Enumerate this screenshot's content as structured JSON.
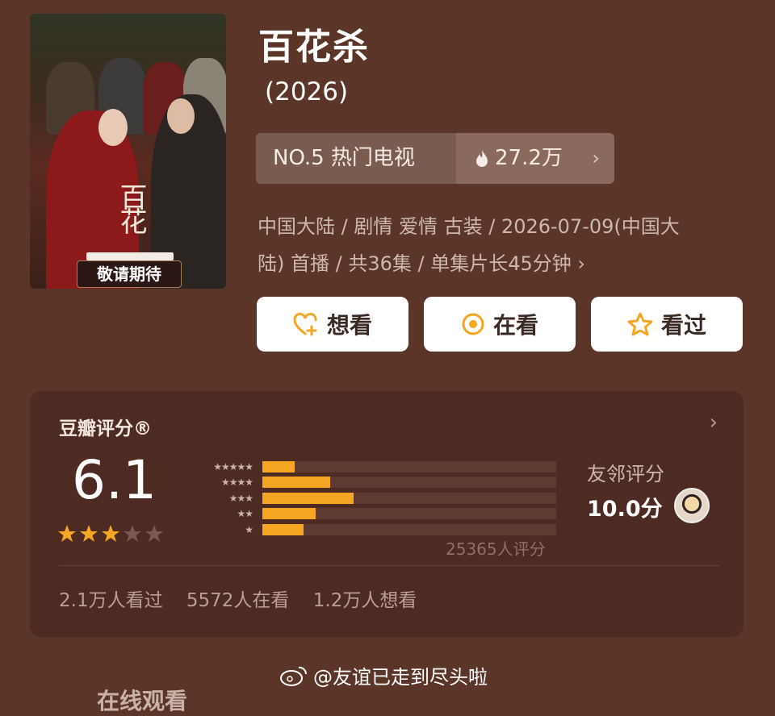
{
  "movie": {
    "title": "百花杀",
    "year": "(2026)",
    "poster_tag": "敬请期待",
    "poster_calligraphy": "百花"
  },
  "rank": {
    "label": "NO.5 热门电视",
    "heat": "27.2万",
    "chevron": "›"
  },
  "meta": {
    "line1": "中国大陆 / 剧情 爱情 古装 / 2026-07-09(中国大",
    "line2": "陆) 首播 / 共36集 / 单集片长45分钟",
    "chevron": "›"
  },
  "actions": [
    {
      "label": "想看",
      "icon": "heart-plus-icon"
    },
    {
      "label": "在看",
      "icon": "target-icon"
    },
    {
      "label": "看过",
      "icon": "star-outline-icon"
    }
  ],
  "rating": {
    "label": "豆瓣评分®",
    "corner": "›",
    "score": "6.1",
    "stars_filled": 3,
    "stars_total": 5,
    "distribution": [
      {
        "stars": "★★★★★",
        "percent": 11
      },
      {
        "stars": "★★★★",
        "percent": 23
      },
      {
        "stars": "★★★",
        "percent": 31
      },
      {
        "stars": "★★",
        "percent": 18
      },
      {
        "stars": "★",
        "percent": 14
      }
    ],
    "count_text": "25365人评分",
    "friend_label": "友邻评分",
    "friend_score": "10.0分",
    "summary": [
      "2.1万人看过",
      "5572人在看",
      "1.2万人想看"
    ]
  },
  "footer": {
    "watermark": "@友谊已走到尽头啦",
    "partial_text": "在线观看"
  },
  "colors": {
    "background": "#5b3528",
    "accent_bar": "#f5a623",
    "star": "#f5a623"
  }
}
